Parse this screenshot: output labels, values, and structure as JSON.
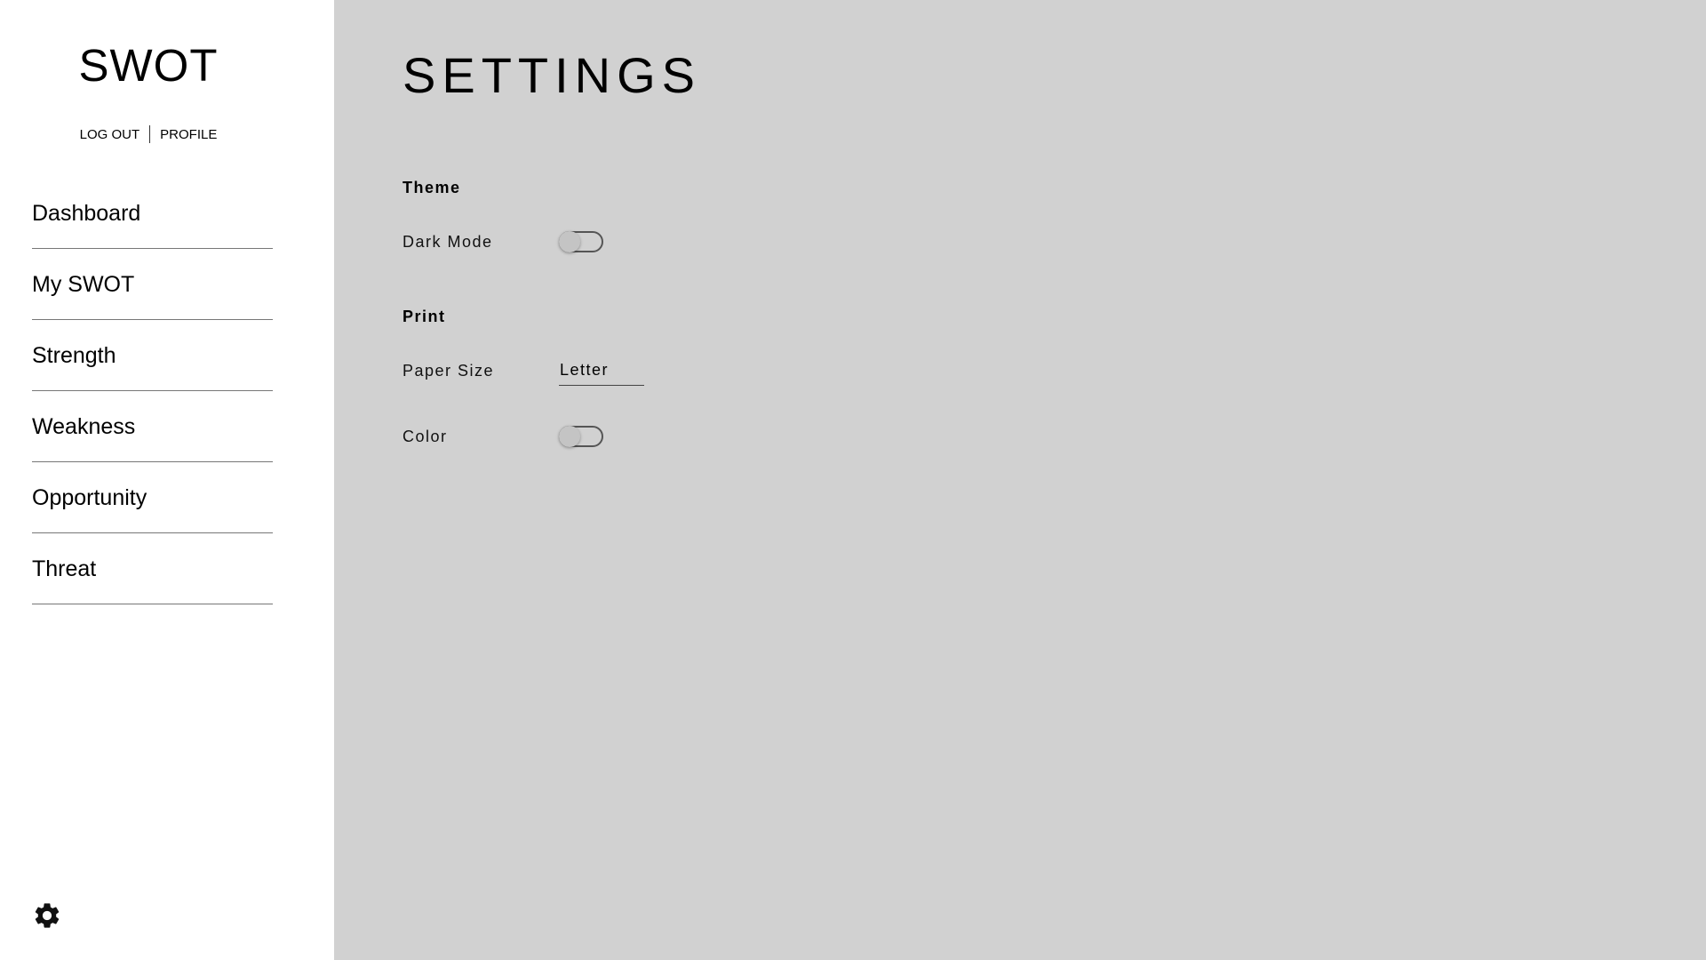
{
  "app": {
    "title": "SWOT"
  },
  "account": {
    "logout_label": "LOG OUT",
    "profile_label": "PROFILE"
  },
  "sidebar": {
    "items": [
      {
        "label": "Dashboard"
      },
      {
        "label": "My SWOT"
      },
      {
        "label": "Strength"
      },
      {
        "label": "Weakness"
      },
      {
        "label": "Opportunity"
      },
      {
        "label": "Threat"
      }
    ],
    "settings_icon": "gear-icon"
  },
  "main": {
    "title": "SETTINGS",
    "theme": {
      "heading": "Theme",
      "dark_mode": {
        "label": "Dark Mode",
        "enabled": false
      }
    },
    "print": {
      "heading": "Print",
      "paper_size": {
        "label": "Paper Size",
        "value": "Letter"
      },
      "color": {
        "label": "Color",
        "enabled": false
      }
    }
  },
  "colors": {
    "sidebar_bg": "#ffffff",
    "main_bg": "#d1d1d1",
    "divider": "#777777",
    "toggle_knob": "#c4c4c4"
  }
}
